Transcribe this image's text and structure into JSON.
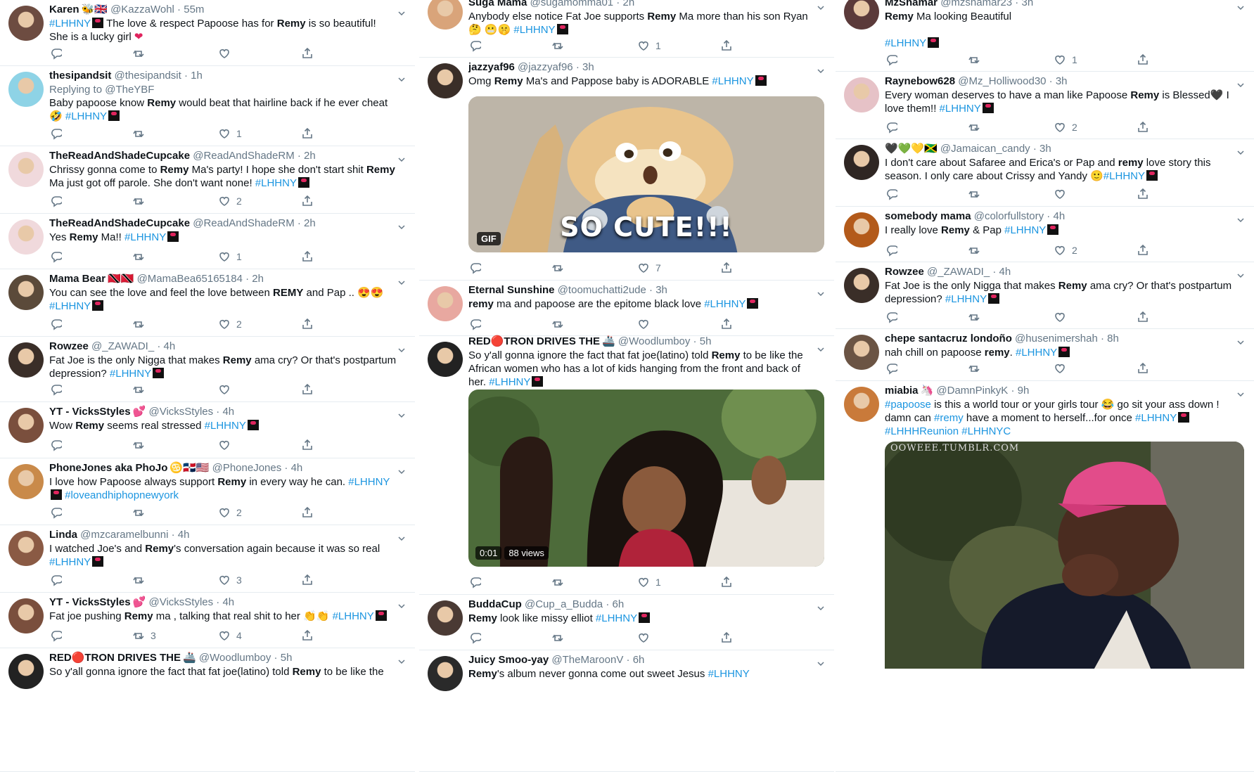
{
  "col1": [
    {
      "name": "Karen",
      "flags": "🐝🇬🇧",
      "handle": "@KazzaWohl",
      "time": "55m",
      "text_html": "<span class='tag'>#LHHNY</span><span class='ml'></span> The love &amp; respect Papoose has for <b>Remy</b> is so beautiful! She is a lucky girl <span class='heart-e'>❤</span>",
      "reply": "",
      "retweet": "",
      "like": ""
    },
    {
      "name": "thesipandsit",
      "flags": "",
      "handle": "@thesipandsit",
      "time": "1h",
      "replying": "Replying to @TheYBF",
      "text_html": "Baby papoose know <b>Remy</b> would beat that hairline back if he ever cheat 🤣 <span class='tag'>#LHHNY</span><span class='ml'></span>",
      "reply": "",
      "retweet": "",
      "like": "1"
    },
    {
      "name": "TheReadAndShadeCupcake",
      "flags": "",
      "handle": "@ReadAndShadeRM",
      "time": "2h",
      "text_html": "Chrissy gonna come to <b>Remy</b> Ma's party! I hope she don't start shit <b>Remy</b> Ma just got off parole. She don't want none! <span class='tag'>#LHHNY</span><span class='ml'></span>",
      "reply": "",
      "retweet": "",
      "like": "2"
    },
    {
      "name": "TheReadAndShadeCupcake",
      "flags": "",
      "handle": "@ReadAndShadeRM",
      "time": "2h",
      "text_html": "Yes <b>Remy</b> Ma!!  <span class='tag'>#LHHNY</span><span class='ml'></span>",
      "reply": "",
      "retweet": "",
      "like": "1"
    },
    {
      "name": "Mama Bear",
      "flags": "🇹🇹🇹🇹",
      "handle": "@MamaBea65165184",
      "time": "2h",
      "text_html": "You can see the love and feel the love between <b>REMY</b> and Pap .. 😍😍 <span class='tag'>#LHHNY</span><span class='ml'></span>",
      "reply": "",
      "retweet": "",
      "like": "2"
    },
    {
      "name": "Rowzee",
      "flags": "",
      "handle": "@_ZAWADI_",
      "time": "4h",
      "text_html": "Fat Joe is the only Nigga that makes <b>Remy</b> ama cry? Or that's postpartum depression? <span class='tag'>#LHHNY</span><span class='ml'></span>",
      "reply": "",
      "retweet": "",
      "like": ""
    },
    {
      "name": "YT - VicksStyles",
      "flags": "💕",
      "handle": "@VicksStyles",
      "time": "4h",
      "text_html": "Wow <b>Remy</b> seems real stressed <span class='tag'>#LHHNY</span><span class='ml'></span>",
      "reply": "",
      "retweet": "",
      "like": ""
    },
    {
      "name": "PhoneJones aka PhoJo",
      "flags": "♋🇩🇴🇺🇸",
      "handle": "@PhoneJones",
      "time": "4h",
      "text_html": "I love how Papoose always support <b>Remy</b> in every way he can. <span class='tag'>#LHHNY</span><span class='ml'></span> <span class='tag'>#loveandhiphopnewyork</span>",
      "reply": "",
      "retweet": "",
      "like": "2"
    },
    {
      "name": "Linda",
      "flags": "",
      "handle": "@mzcaramelbunni",
      "time": "4h",
      "text_html": "I watched Joe's and <b>Remy</b>'s conversation again because it was so real <span class='tag'>#LHHNY</span><span class='ml'></span>",
      "reply": "",
      "retweet": "",
      "like": "3"
    },
    {
      "name": "YT - VicksStyles",
      "flags": "💕",
      "handle": "@VicksStyles",
      "time": "4h",
      "text_html": "Fat joe pushing <b>Remy</b> ma , talking that real shit to her 👏👏 <span class='tag'>#LHHNY</span><span class='ml'></span>",
      "reply": "",
      "retweet": "3",
      "like": "4"
    },
    {
      "name": "RED🔴TRON DRIVES THE",
      "flags": "🚢",
      "handle": "@Woodlumboy",
      "time": "5h",
      "text_html": "So y'all gonna ignore the fact that fat joe(latino) told <b>Remy</b> to be like the",
      "reply": "",
      "retweet": "",
      "like": ""
    }
  ],
  "col2": [
    {
      "name": "Suga Mama",
      "flags": "",
      "handle": "@sugamomma01",
      "time": "2h",
      "text_html": "Anybody else notice Fat Joe supports <b>Remy</b> Ma more than his son Ryan 🤔 😬🤫 <span class='tag'>#LHHNY</span><span class='ml'></span>",
      "reply": "",
      "retweet": "",
      "like": "1"
    },
    {
      "name": "jazzyaf96",
      "flags": "",
      "handle": "@jazzyaf96",
      "time": "3h",
      "text_html": "Omg <b>Remy</b> Ma's and Pappose baby is ADORABLE <span class='tag'>#LHHNY</span><span class='ml'></span>",
      "media": {
        "kind": "gif",
        "badge": "GIF",
        "caption": "SO CUTE!!!"
      },
      "reply": "",
      "retweet": "",
      "like": "7"
    },
    {
      "name": "Eternal Sunshine",
      "flags": "",
      "handle": "@toomuchatti2ude",
      "time": "3h",
      "text_html": "<b>remy</b> ma and papoose are the epitome black love <span class='tag'>#LHHNY</span><span class='ml'></span>",
      "reply": "",
      "retweet": "",
      "like": ""
    },
    {
      "name": "RED🔴TRON DRIVES THE",
      "flags": "🚢",
      "handle": "@Woodlumboy",
      "time": "5h",
      "text_html": "So y'all gonna ignore the fact that fat joe(latino) told <b>Remy</b> to be like the African women who has a lot of kids hanging from the front and back of her. <span class='tag'>#LHHNY</span><span class='ml'></span>",
      "media": {
        "kind": "video",
        "time": "0:01",
        "views": "88 views"
      },
      "reply": "",
      "retweet": "",
      "like": "1"
    },
    {
      "name": "BuddaCup",
      "flags": "",
      "handle": "@Cup_a_Budda",
      "time": "6h",
      "text_html": "<b>Remy</b> look like missy elliot <span class='tag'>#LHHNY</span><span class='ml'></span>",
      "reply": "",
      "retweet": "",
      "like": ""
    },
    {
      "name": "Juicy Smoo-yay",
      "flags": "",
      "handle": "@TheMaroonV",
      "time": "6h",
      "text_html": "<b>Remy</b>'s album never gonna come out sweet Jesus <span class='tag'>#LHHNY</span>",
      "reply": "",
      "retweet": "",
      "like": ""
    }
  ],
  "col3": [
    {
      "name": "MzShamar",
      "flags": "",
      "handle": "@mzshamar23",
      "time": "3h",
      "text_html": "<b>Remy</b> Ma looking Beautiful<br><br><span class='tag'>#LHHNY</span><span class='ml'></span>",
      "reply": "",
      "retweet": "",
      "like": "1"
    },
    {
      "name": "Raynebow628",
      "flags": "",
      "handle": "@Mz_Holliwood30",
      "time": "3h",
      "text_html": "Every woman deserves to have a man like Papoose <b>Remy</b> is Blessed🖤 I love them!! <span class='tag'>#LHHNY</span><span class='ml'></span>",
      "reply": "",
      "retweet": "",
      "like": "2"
    },
    {
      "name": "🖤💚💛🇯🇲",
      "flags": "",
      "handle": "@Jamaican_candy",
      "time": "3h",
      "text_html": "I don't care about Safaree and Erica's or Pap and <b>remy</b> love story this season. I only care about Crissy and Yandy 🙂<span class='tag'>#LHHNY</span><span class='ml'></span>",
      "reply": "",
      "retweet": "",
      "like": ""
    },
    {
      "name": "somebody mama",
      "flags": "",
      "handle": "@colorfullstory",
      "time": "4h",
      "text_html": "I really love <b>Remy</b> &amp; Pap <span class='tag'>#LHHNY</span><span class='ml'></span>",
      "reply": "",
      "retweet": "",
      "like": "2"
    },
    {
      "name": "Rowzee",
      "flags": "",
      "handle": "@_ZAWADI_",
      "time": "4h",
      "text_html": "Fat Joe is the only Nigga that makes <b>Remy</b> ama cry? Or that's postpartum depression? <span class='tag'>#LHHNY</span><span class='ml'></span>",
      "reply": "",
      "retweet": "",
      "like": ""
    },
    {
      "name": "chepe santacruz londoño",
      "flags": "",
      "handle": "@husenimershah",
      "time": "8h",
      "text_html": "nah chill on papoose <b>remy</b>. <span class='tag'>#LHHNY</span><span class='ml'></span>",
      "reply": "",
      "retweet": "",
      "like": ""
    },
    {
      "name": "miabia",
      "flags": "🦄",
      "handle": "@DamnPinkyK",
      "time": "9h",
      "text_html": "<span class='tag'>#papoose</span> is this a world tour or your girls tour 😂 go sit your ass down ! damn can <span class='tag'>#remy</span> have a moment to herself...for once <span class='tag'>#LHHNY</span><span class='ml'></span> <span class='tag'>#LHHHReunion</span> <span class='tag'>#LHHNYC</span>",
      "media": {
        "kind": "photo",
        "watermark": "OOWEEE.TUMBLR.COM"
      },
      "reply": "",
      "retweet": "",
      "like": ""
    }
  ],
  "colors": {
    "link": "#1b95e0",
    "icon": "#657786",
    "divider": "#e6ecf0"
  }
}
